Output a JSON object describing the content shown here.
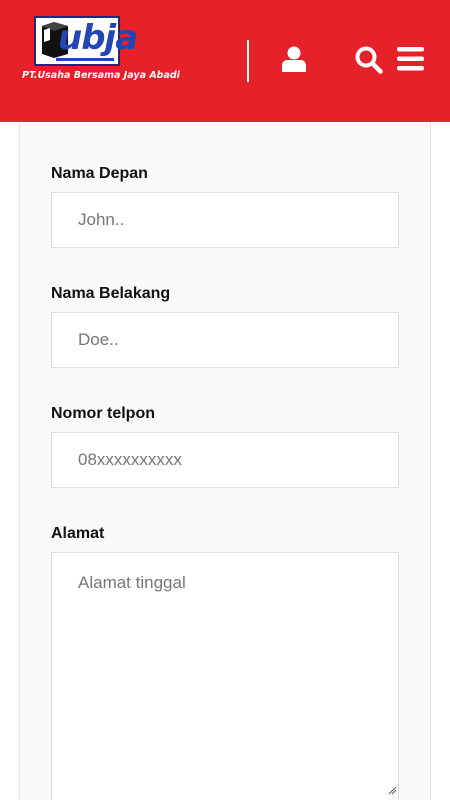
{
  "header": {
    "brand": {
      "logo_text": "ubja",
      "tagline": "PT.Usaha Bersama Jaya Abadi"
    },
    "icons": [
      "user-icon",
      "search-icon",
      "menu-icon"
    ],
    "background_color": "#e52129"
  },
  "form": {
    "first_name": {
      "label": "Nama Depan",
      "placeholder": "John.."
    },
    "last_name": {
      "label": "Nama Belakang",
      "placeholder": "Doe.."
    },
    "phone": {
      "label": "Nomor telpon",
      "placeholder": "08xxxxxxxxxx"
    },
    "address": {
      "label": "Alamat",
      "placeholder": "Alamat tinggal"
    }
  }
}
